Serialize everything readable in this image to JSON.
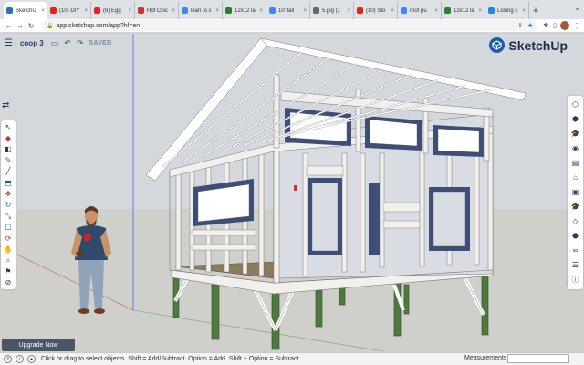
{
  "browser": {
    "tabs": [
      {
        "label": "SketchU",
        "active": true,
        "color": "#2f6fbf"
      },
      {
        "label": "(10) DIY",
        "color": "#e62117"
      },
      {
        "label": "(6) Egg",
        "color": "#e62117"
      },
      {
        "label": "Hot Chic",
        "color": "#c0392b"
      },
      {
        "label": "lean to c",
        "color": "#4285f4"
      },
      {
        "label": "12x12 la",
        "color": "#2e7d32"
      },
      {
        "label": "10' tall",
        "color": "#4285f4"
      },
      {
        "label": "5.jpg (1",
        "color": "#666666"
      },
      {
        "label": "(10) Sto",
        "color": "#e62117"
      },
      {
        "label": "roof pu",
        "color": "#4285f4"
      },
      {
        "label": "12x12 la",
        "color": "#2e7d32"
      },
      {
        "label": "Losing c",
        "color": "#1e88e5"
      }
    ],
    "new_tab": "+",
    "url": "app.sketchup.com/app?hl=en"
  },
  "sketchup": {
    "project_name": "coop 3",
    "save_status": "SAVED",
    "brand": "SketchUp"
  },
  "upgrade_label": "Upgrade Now",
  "status_bar": {
    "hint": "Click or drag to select objects. Shift = Add/Subtract. Option = Add. Shift + Option = Subtract.",
    "measurements_label": "Measurements"
  },
  "icons": {
    "left_tools": [
      "select-icon",
      "eraser-icon",
      "paint-bucket-icon",
      "pencil-icon",
      "line-icon",
      "push-pull-icon",
      "move-icon",
      "rotate-icon",
      "scale-icon",
      "offset-icon",
      "orbit-icon",
      "pan-icon",
      "zoom-icon",
      "walk-icon",
      "section-icon"
    ],
    "right_tools": [
      "entity-info-icon",
      "components-icon",
      "materials-icon",
      "styles-icon",
      "layers-icon",
      "scenes-icon",
      "display-icon",
      "instructor-icon",
      "tag-icon",
      "solid-tools-icon",
      "glasses-icon",
      "outliner-icon",
      "info-icon"
    ]
  },
  "colors": {
    "accent": "#1b5ea8",
    "wood": "#f2f0ec",
    "posts": "#4f7a3e",
    "frame_blue": "#3d4f78",
    "floor": "#8a7a5e"
  }
}
